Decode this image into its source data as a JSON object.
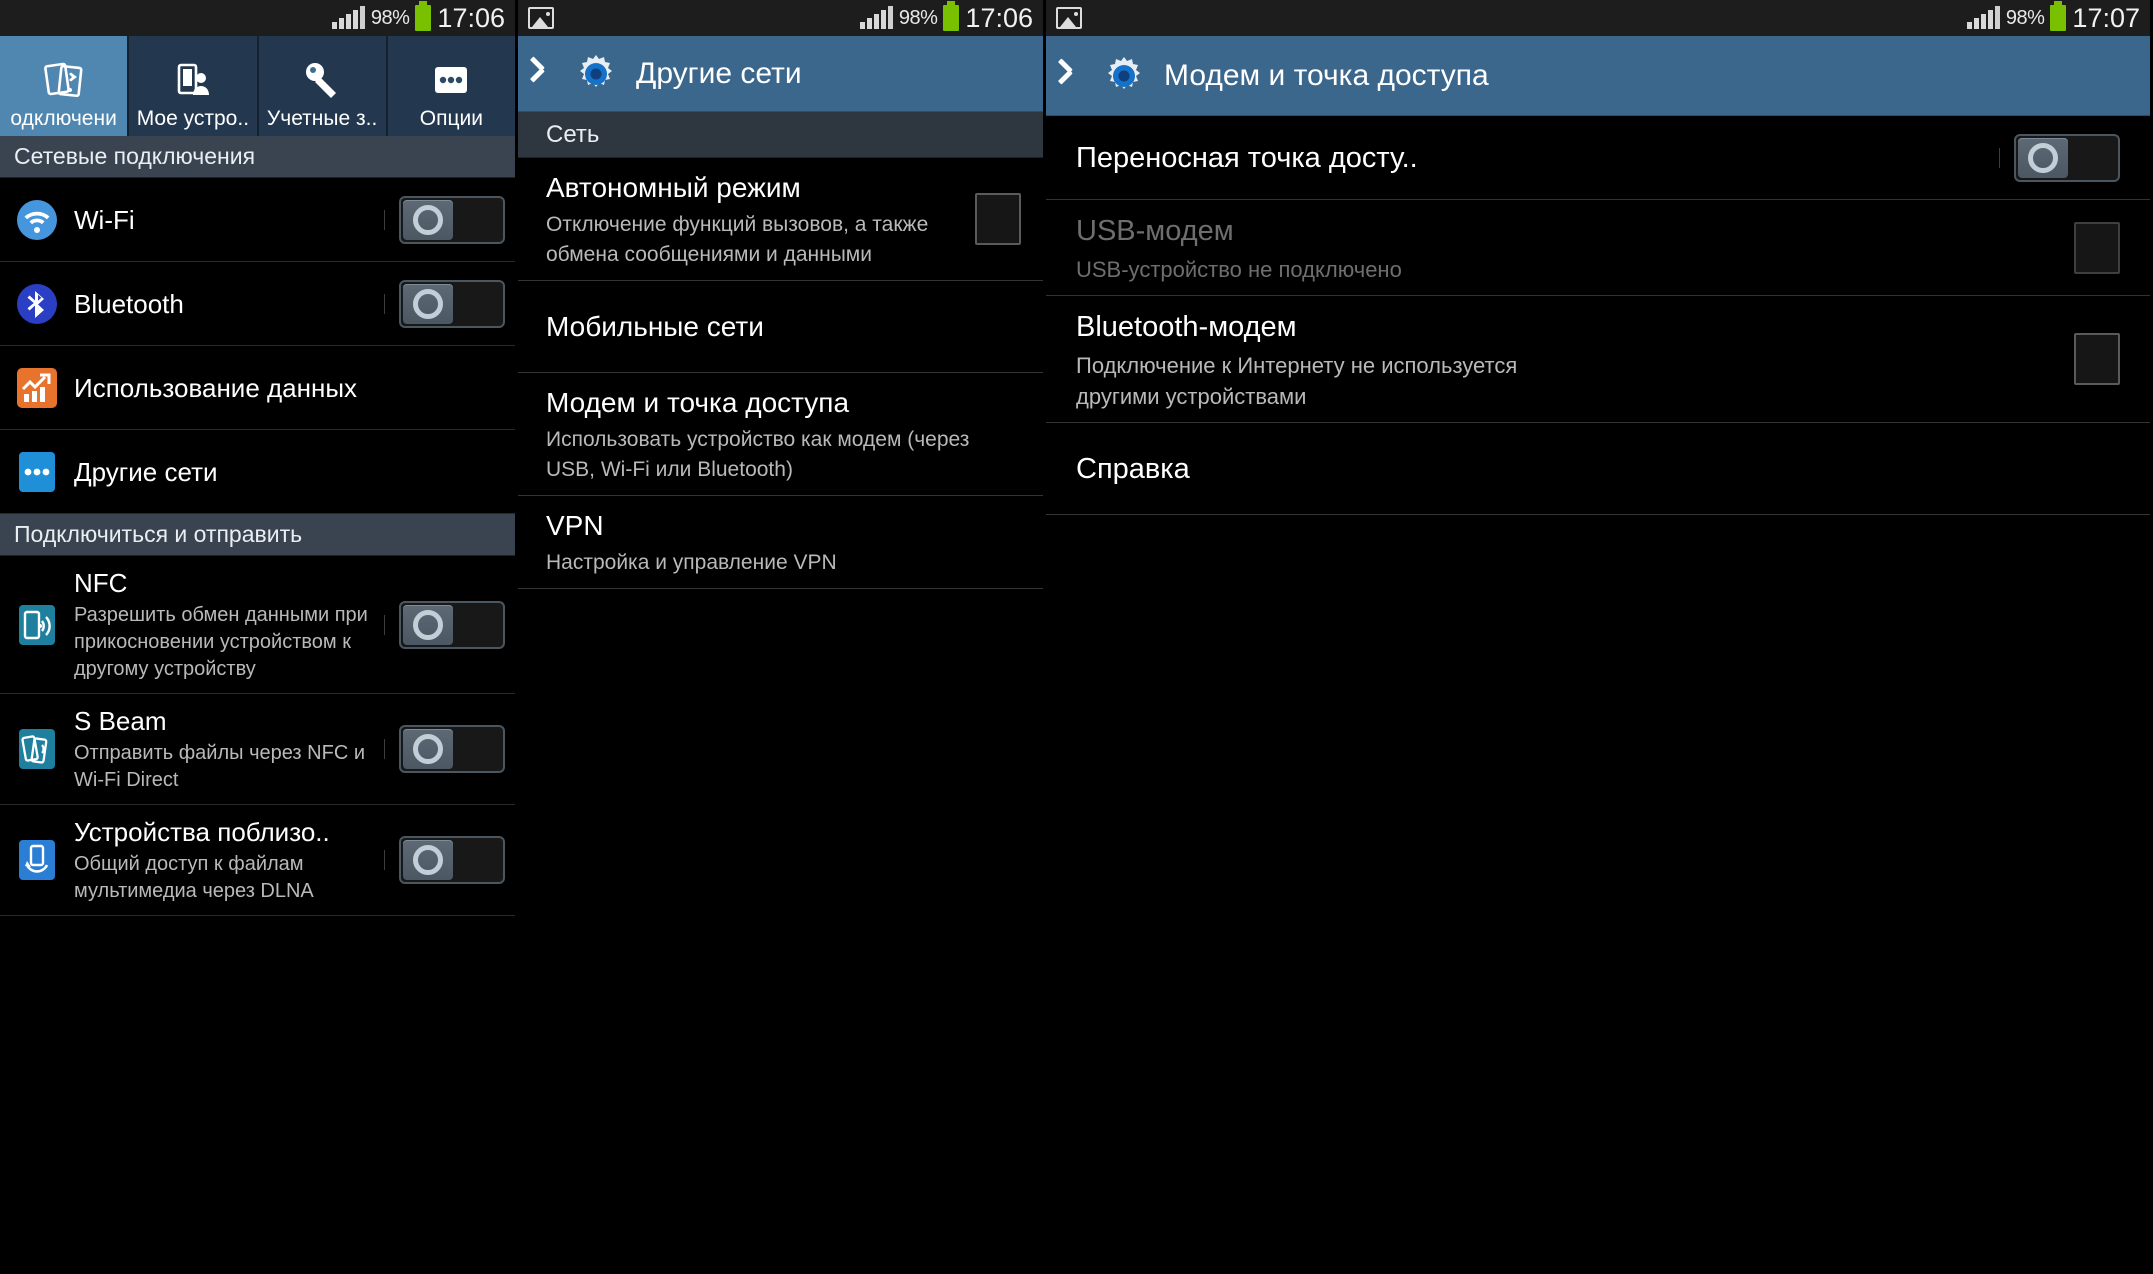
{
  "statusbar": {
    "battery_percent": "98%",
    "time_left": "17:06",
    "time_mid": "17:06",
    "time_right": "17:07",
    "battery_color": "#78c000",
    "icons": {
      "image": "image-icon",
      "signal": "signal-bars-icon",
      "battery": "battery-icon"
    }
  },
  "panel1": {
    "tabs": [
      {
        "label": "одключени",
        "icon": "connections-icon",
        "active": true
      },
      {
        "label": "Мое устро..",
        "icon": "my-device-icon",
        "active": false
      },
      {
        "label": "Учетные з..",
        "icon": "accounts-key-icon",
        "active": false
      },
      {
        "label": "Опции",
        "icon": "more-options-icon",
        "active": false
      }
    ],
    "sections": [
      {
        "header": "Сетевые подключения",
        "rows": [
          {
            "title": "Wi-Fi",
            "sub": "",
            "icon": "wifi-icon",
            "icon_color": "#3d8fd6",
            "control": "toggle",
            "state": "off"
          },
          {
            "title": "Bluetooth",
            "sub": "",
            "icon": "bluetooth-icon",
            "icon_color": "#2b43c4",
            "control": "toggle",
            "state": "off"
          },
          {
            "title": "Использование данных",
            "sub": "",
            "icon": "data-usage-icon",
            "icon_color": "#e8732c",
            "control": "none"
          },
          {
            "title": "Другие сети",
            "sub": "",
            "icon": "other-networks-icon",
            "icon_color": "#1f8fd8",
            "control": "none"
          }
        ]
      },
      {
        "header": "Подключиться и отправить",
        "rows": [
          {
            "title": "NFC",
            "sub": "Разрешить обмен данными при прикосновении устройством к другому устройству",
            "icon": "nfc-icon",
            "icon_color": "#1f7f9e",
            "control": "toggle",
            "state": "off"
          },
          {
            "title": "S Beam",
            "sub": "Отправить файлы через NFC и Wi-Fi Direct",
            "icon": "s-beam-icon",
            "icon_color": "#1f7f9e",
            "control": "toggle",
            "state": "off"
          },
          {
            "title": "Устройства поблизо..",
            "sub": "Общий доступ к файлам мультимедиа через DLNA",
            "icon": "nearby-devices-icon",
            "icon_color": "#2a7fd4",
            "control": "toggle",
            "state": "off"
          }
        ]
      }
    ]
  },
  "panel2": {
    "title": "Другие сети",
    "section_header": "Сеть",
    "rows": [
      {
        "title": "Автономный режим",
        "sub": "Отключение функций вызовов, а также обмена сообщениями и данными",
        "control": "checkbox",
        "state": "unchecked"
      },
      {
        "title": "Мобильные сети",
        "sub": "",
        "control": "none"
      },
      {
        "title": "Модем и точка доступа",
        "sub": "Использовать устройство как модем (через USB, Wi-Fi или Bluetooth)",
        "control": "none"
      },
      {
        "title": "VPN",
        "sub": "Настройка и управление VPN",
        "control": "none"
      }
    ]
  },
  "panel3": {
    "title": "Модем и точка доступа",
    "rows": [
      {
        "title": "Переносная точка досту..",
        "sub": "",
        "control": "toggle",
        "state": "off",
        "disabled": false
      },
      {
        "title": "USB-модем",
        "sub": "USB-устройство не подключено",
        "control": "checkbox",
        "state": "unchecked",
        "disabled": true
      },
      {
        "title": "Bluetooth-модем",
        "sub": "Подключение к Интернету не используется другими устройствами",
        "control": "checkbox",
        "state": "unchecked",
        "disabled": false
      },
      {
        "title": "Справка",
        "sub": "",
        "control": "none",
        "disabled": false
      }
    ]
  }
}
